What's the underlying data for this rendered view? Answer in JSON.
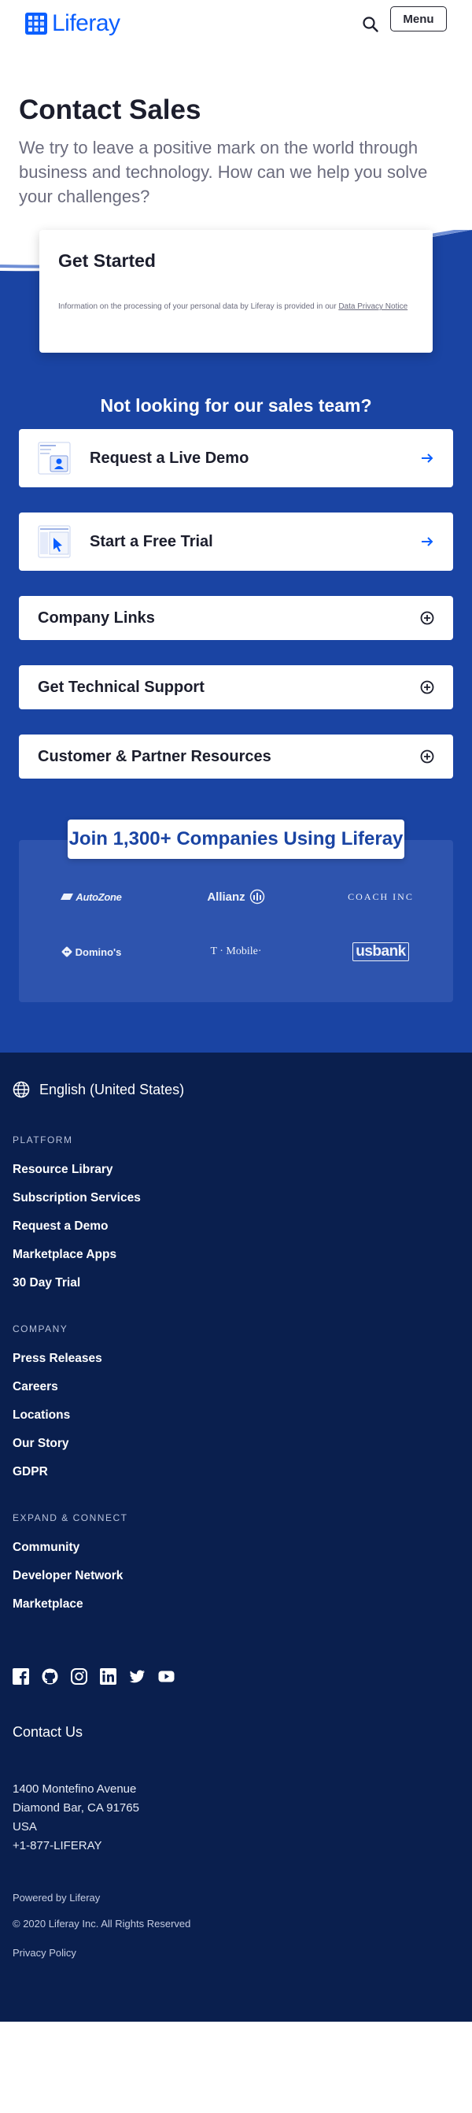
{
  "header": {
    "logo_text": "Liferay",
    "menu_label": "Menu",
    "brand_color": "#0b5fff"
  },
  "hero": {
    "title": "Contact Sales",
    "subtitle": "We try to leave a positive mark on the world through business and technology. How can we help you solve your challenges?"
  },
  "get_started": {
    "title": "Get Started",
    "privacy_text": "Information on the processing of your personal data by Liferay is provided in our ",
    "privacy_link": "Data Privacy Notice"
  },
  "alt_section": {
    "title": "Not looking for our sales team?",
    "actions": [
      {
        "label": "Request a Live Demo",
        "icon": "demo-illustration-icon"
      },
      {
        "label": "Start a Free Trial",
        "icon": "trial-illustration-icon"
      }
    ],
    "accordions": [
      {
        "label": "Company Links"
      },
      {
        "label": "Get Technical Support"
      },
      {
        "label": "Customer & Partner Resources"
      }
    ]
  },
  "companies": {
    "title": "Join 1,300+ Companies Using Liferay",
    "brands": [
      "AutoZone",
      "Allianz",
      "COACH INC",
      "Domino's",
      "T · Mobile·",
      "usbank"
    ]
  },
  "footer": {
    "language": "English (United States)",
    "sections": [
      {
        "heading": "PLATFORM",
        "links": [
          "Resource Library",
          "Subscription Services",
          "Request a Demo",
          "Marketplace Apps",
          "30 Day Trial"
        ]
      },
      {
        "heading": "COMPANY",
        "links": [
          "Press Releases",
          "Careers",
          "Locations",
          "Our Story",
          "GDPR"
        ]
      },
      {
        "heading": "EXPAND & CONNECT",
        "links": [
          "Community",
          "Developer Network",
          "Marketplace"
        ]
      }
    ],
    "socials": [
      "facebook-icon",
      "github-icon",
      "instagram-icon",
      "linkedin-icon",
      "twitter-icon",
      "youtube-icon"
    ],
    "contact_title": "Contact Us",
    "address": [
      "1400 Montefino Avenue",
      "Diamond Bar, CA 91765",
      "USA",
      "+1-877-LIFERAY"
    ],
    "powered_by": "Powered by Liferay",
    "copyright": "© 2020 Liferay Inc. All Rights Reserved",
    "privacy_policy": "Privacy Policy"
  },
  "colors": {
    "blue_section": "#1a44a3",
    "footer_bg": "#0a1f4e",
    "accent": "#0b5fff"
  }
}
